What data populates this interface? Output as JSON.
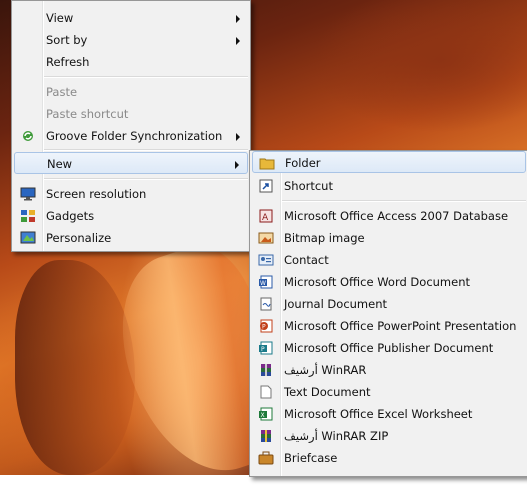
{
  "context_menu": {
    "items": [
      {
        "label": "View",
        "submenu": true
      },
      {
        "label": "Sort by",
        "submenu": true
      },
      {
        "label": "Refresh"
      },
      {
        "label": "Paste",
        "disabled": true
      },
      {
        "label": "Paste shortcut",
        "disabled": true
      },
      {
        "label": "Groove Folder Synchronization",
        "submenu": true,
        "icon": "groove-sync-icon"
      },
      {
        "label": "New",
        "submenu": true,
        "highlighted": true
      },
      {
        "label": "Screen resolution",
        "icon": "screen-resolution-icon"
      },
      {
        "label": "Gadgets",
        "icon": "gadgets-icon"
      },
      {
        "label": "Personalize",
        "icon": "personalize-icon"
      }
    ]
  },
  "new_submenu": {
    "items": [
      {
        "label": "Folder",
        "icon": "folder-icon",
        "highlighted": true
      },
      {
        "label": "Shortcut",
        "icon": "shortcut-icon"
      },
      {
        "label": "Microsoft Office Access 2007 Database",
        "icon": "access-db-icon"
      },
      {
        "label": "Bitmap image",
        "icon": "bitmap-image-icon"
      },
      {
        "label": "Contact",
        "icon": "contact-icon"
      },
      {
        "label": "Microsoft Office Word Document",
        "icon": "word-document-icon"
      },
      {
        "label": "Journal Document",
        "icon": "journal-document-icon"
      },
      {
        "label": "Microsoft Office PowerPoint Presentation",
        "icon": "powerpoint-icon"
      },
      {
        "label": "Microsoft Office Publisher Document",
        "icon": "publisher-icon"
      },
      {
        "label": "أرشيف WinRAR",
        "icon": "winrar-archive-icon"
      },
      {
        "label": "Text Document",
        "icon": "text-document-icon"
      },
      {
        "label": "Microsoft Office Excel Worksheet",
        "icon": "excel-worksheet-icon"
      },
      {
        "label": "أرشيف WinRAR ZIP",
        "icon": "winrar-zip-icon"
      },
      {
        "label": "Briefcase",
        "icon": "briefcase-icon"
      }
    ]
  }
}
